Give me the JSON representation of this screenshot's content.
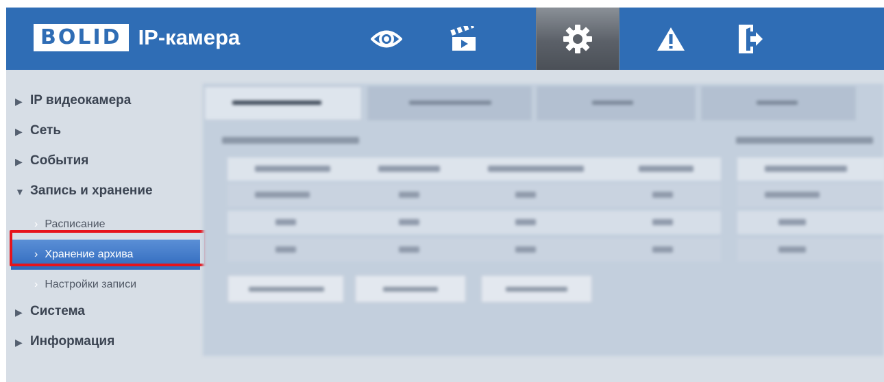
{
  "header": {
    "logo_badge": "BOLID",
    "title": "IP-камера",
    "nav": [
      {
        "name": "live-view",
        "icon": "eye-icon",
        "active": false
      },
      {
        "name": "playback",
        "icon": "clapperboard-icon",
        "active": false
      },
      {
        "name": "settings",
        "icon": "gear-icon",
        "active": true
      },
      {
        "name": "alarm",
        "icon": "warning-icon",
        "active": false
      },
      {
        "name": "logout",
        "icon": "exit-icon",
        "active": false
      }
    ]
  },
  "sidebar": {
    "items": [
      {
        "label": "IP видеокамера",
        "expanded": false
      },
      {
        "label": "Сеть",
        "expanded": false
      },
      {
        "label": "События",
        "expanded": false
      },
      {
        "label": "Запись и хранение",
        "expanded": true,
        "children": [
          {
            "label": "Расписание",
            "selected": false
          },
          {
            "label": "Хранение архива",
            "selected": true
          },
          {
            "label": "Настройки записи",
            "selected": false
          }
        ]
      },
      {
        "label": "Система",
        "expanded": false
      },
      {
        "label": "Информация",
        "expanded": false
      }
    ]
  },
  "colors": {
    "header_bg": "#2f6db5",
    "content_bg": "#d7dee6",
    "selected_item": "#3f77c8",
    "highlight_border": "#e6131b"
  }
}
